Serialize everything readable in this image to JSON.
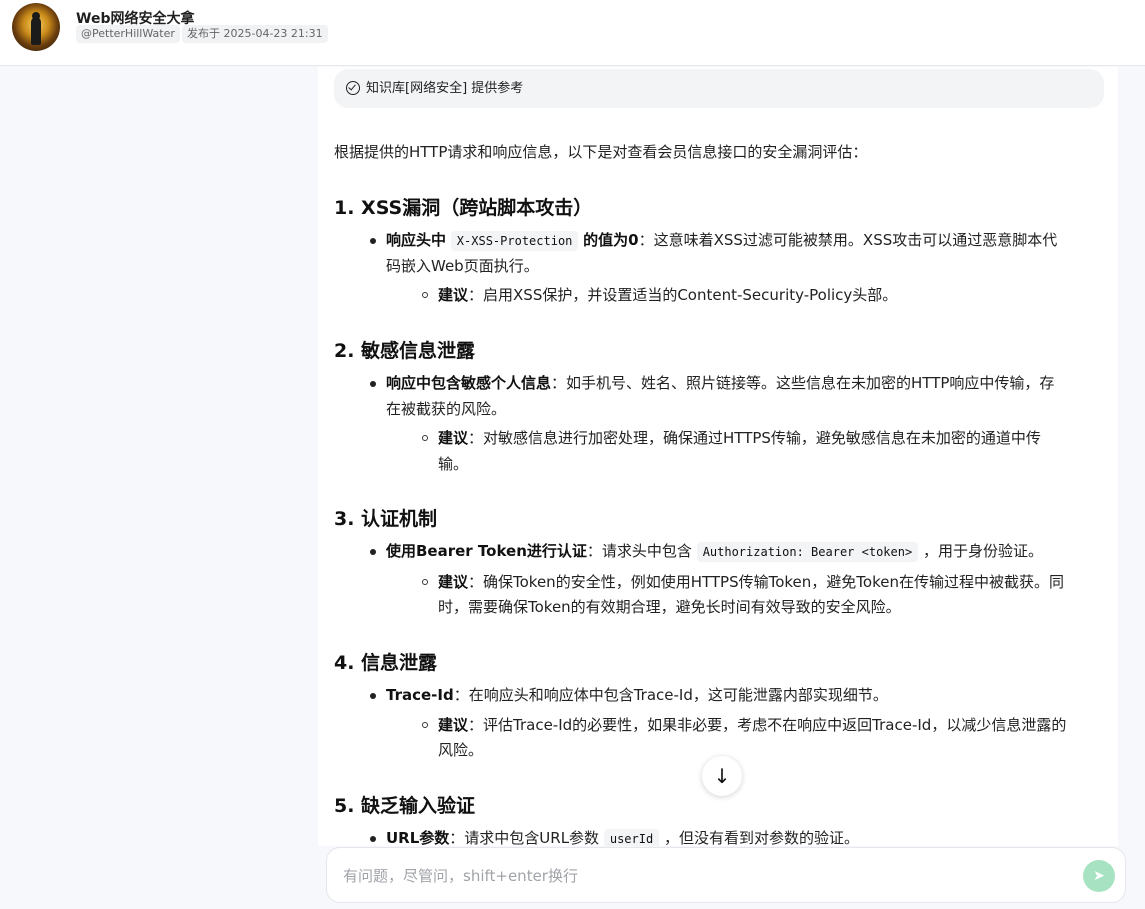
{
  "header": {
    "title": "Web网络安全大拿",
    "username": "@PetterHillWater",
    "published": "发布于 2025-04-23 21:31"
  },
  "kb_notice": "知识库[网络安全] 提供参考",
  "intro": "根据提供的HTTP请求和响应信息，以下是对查看会员信息接口的安全漏洞评估：",
  "sections": [
    {
      "heading": "1. XSS漏洞（跨站脚本攻击）",
      "point_bold_a": "响应头中",
      "point_code": "X-XSS-Protection",
      "point_bold_b": "的值为0",
      "point_text_1": "：这意味着XSS过滤可能被禁用。XSS攻击可以通过恶意脚本代",
      "point_text_2": "码嵌入Web页面执行。",
      "advice_label": "建议",
      "advice_1": "：启用XSS保护，并设置适当的Content-Security-Policy头部。"
    },
    {
      "heading": "2. 敏感信息泄露",
      "point_bold": "响应中包含敏感个人信息",
      "point_text_1": "：如手机号、姓名、照片链接等。这些信息在未加密的HTTP响应中传输，存",
      "point_text_2": "在被截获的风险。",
      "advice_label": "建议",
      "advice_1": "：对敏感信息进行加密处理，确保通过HTTPS传输，避免敏感信息在未加密的通道中传",
      "advice_2": "输。"
    },
    {
      "heading": "3. 认证机制",
      "point_bold": "使用Bearer Token进行认证",
      "point_text_a": "：请求头中包含",
      "point_code": "Authorization: Bearer <token>",
      "point_text_b": "，用于身份验证。",
      "advice_label": "建议",
      "advice_1": "：确保Token的安全性，例如使用HTTPS传输Token，避免Token在传输过程中被截获。同",
      "advice_2": "时，需要确保Token的有效期合理，避免长时间有效导致的安全风险。"
    },
    {
      "heading": "4. 信息泄露",
      "point_bold": "Trace-Id",
      "point_text_1": "：在响应头和响应体中包含Trace-Id，这可能泄露内部实现细节。",
      "advice_label": "建议",
      "advice_1": "：评估Trace-Id的必要性，如果非必要，考虑不在响应中返回Trace-Id，以减少信息泄露的",
      "advice_2": "风险。"
    },
    {
      "heading": "5. 缺乏输入验证",
      "point_bold": "URL参数",
      "point_text_a": "：请求中包含URL参数",
      "point_code": "userId",
      "point_text_b": "，但没有看到对参数的验证。"
    }
  ],
  "input": {
    "placeholder": "有问题，尽管问，shift+enter换行"
  },
  "icons": {
    "scroll": "arrow-down-icon",
    "send": "send-icon",
    "check": "check-circle-icon"
  },
  "colors": {
    "background": "#f6f8fc",
    "send_button": "#a7e3c3"
  }
}
